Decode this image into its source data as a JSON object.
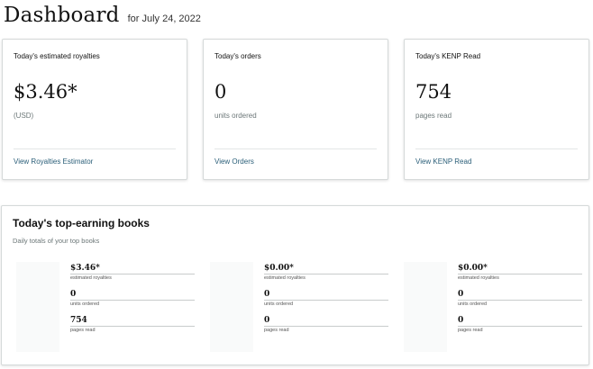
{
  "header": {
    "title": "Dashboard",
    "date": "for July 24, 2022"
  },
  "cards": [
    {
      "label": "Today's estimated royalties",
      "value": "$3.46*",
      "sub": "(USD)",
      "link": "View Royalties Estimator"
    },
    {
      "label": "Today's orders",
      "value": "0",
      "sub": "units ordered",
      "link": "View Orders"
    },
    {
      "label": "Today's KENP Read",
      "value": "754",
      "sub": "pages read",
      "link": "View KENP Read"
    }
  ],
  "top_books": {
    "title": "Today's top-earning books",
    "subtitle": "Daily totals of your top books",
    "books": [
      {
        "royalties": "$3.46*",
        "royalties_label": "estimated royalties",
        "units": "0",
        "units_label": "units ordered",
        "pages": "754",
        "pages_label": "pages read"
      },
      {
        "royalties": "$0.00*",
        "royalties_label": "estimated royalties",
        "units": "0",
        "units_label": "units ordered",
        "pages": "0",
        "pages_label": "pages read"
      },
      {
        "royalties": "$0.00*",
        "royalties_label": "estimated royalties",
        "units": "0",
        "units_label": "units ordered",
        "pages": "0",
        "pages_label": "pages read"
      }
    ]
  }
}
